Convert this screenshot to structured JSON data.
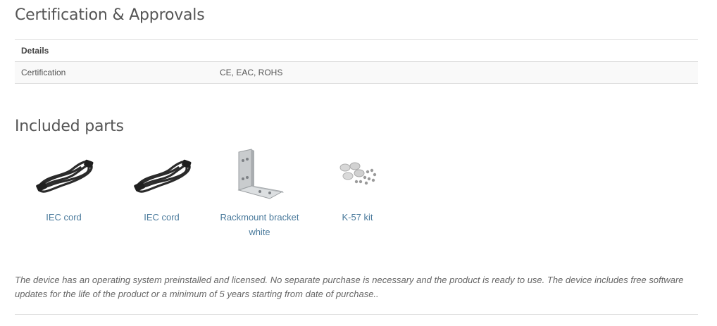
{
  "certification": {
    "title": "Certification & Approvals",
    "table": {
      "header": "Details",
      "rows": [
        {
          "key": "Certification",
          "value": "CE, EAC, ROHS"
        }
      ]
    }
  },
  "included_parts": {
    "title": "Included parts",
    "items": [
      {
        "label": "IEC cord",
        "icon": "power-cord-icon"
      },
      {
        "label": "IEC cord",
        "icon": "power-cord-icon"
      },
      {
        "label": "Rackmount bracket white",
        "icon": "rackmount-bracket-icon"
      },
      {
        "label": "K-57 kit",
        "icon": "screw-kit-icon"
      }
    ]
  },
  "note": "The device has an operating system preinstalled and licensed. No separate purchase is necessary and the product is ready to use. The device includes free software updates for the life of the product or a minimum of 5 years starting from date of purchase..",
  "colors": {
    "link": "#4a7a9c",
    "heading": "#555555",
    "border": "#dddddd",
    "row_shade": "#f9f9f9"
  }
}
